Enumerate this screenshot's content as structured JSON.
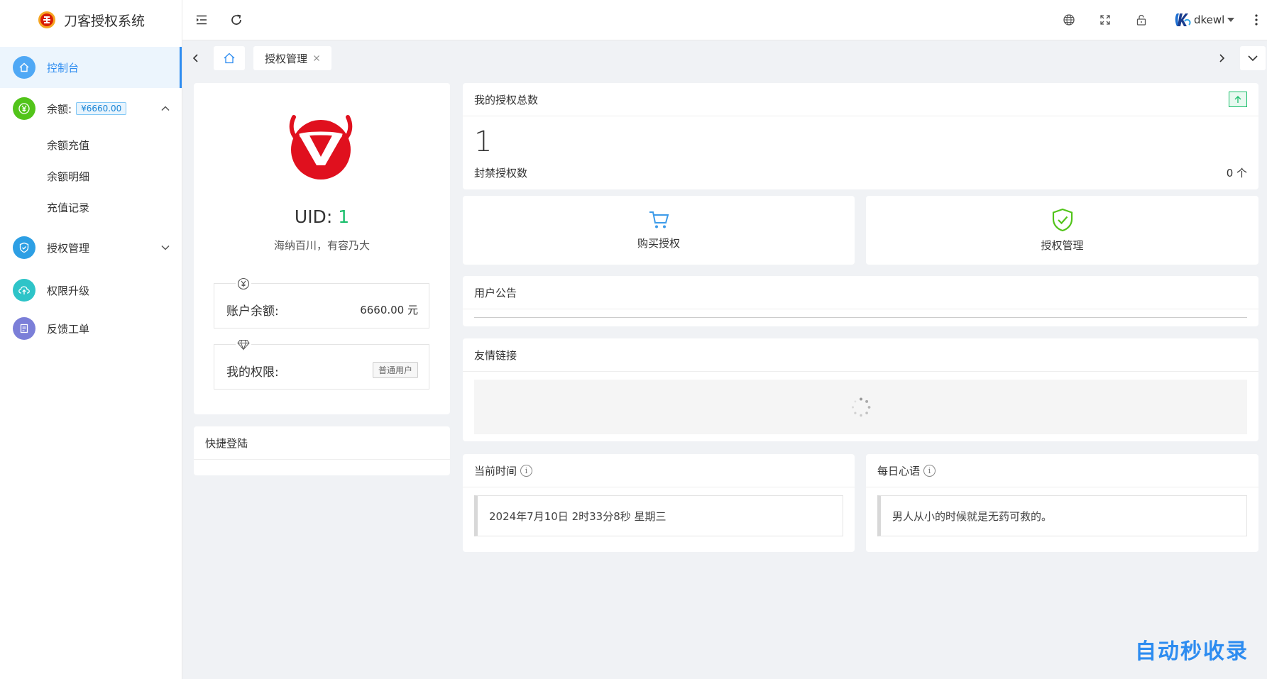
{
  "app": {
    "title": "刀客授权系统"
  },
  "sidebar": {
    "items": [
      {
        "label": "控制台",
        "icon": "home-icon",
        "color": "#4fa8f5",
        "active": true
      },
      {
        "label": "余额:",
        "badge": "¥6660.00",
        "icon": "yen-icon",
        "color": "#52c41a",
        "expanded": true,
        "children": [
          "余额充值",
          "余额明细",
          "充值记录"
        ]
      },
      {
        "label": "授权管理",
        "icon": "shield-icon",
        "color": "#2d9fe4",
        "expanded": false
      },
      {
        "label": "权限升级",
        "icon": "cloud-upload-icon",
        "color": "#2ec4c8"
      },
      {
        "label": "反馈工单",
        "icon": "document-icon",
        "color": "#7b7fd8"
      }
    ]
  },
  "header": {
    "icons": [
      "menu-fold-icon",
      "refresh-icon",
      "globe-icon",
      "fullscreen-icon",
      "lock-icon",
      "more-icon"
    ],
    "user": {
      "name": "dkewl"
    }
  },
  "tabs": [
    {
      "type": "home",
      "icon": "home-icon"
    },
    {
      "label": "授权管理",
      "closable": true
    }
  ],
  "profile": {
    "uid_label": "UID: ",
    "uid": "1",
    "motto": "海纳百川，有容乃大",
    "balance_label": "账户余额:",
    "balance_value": "6660.00 元",
    "role_label": "我的权限:",
    "role_value": "普通用户"
  },
  "quick_login": {
    "title": "快捷登陆"
  },
  "auth_stats": {
    "title": "我的授权总数",
    "total": "1",
    "banned_label": "封禁授权数",
    "banned_value": "0 个"
  },
  "quick_actions": [
    {
      "label": "购买授权",
      "icon": "cart-icon",
      "color": "#3d9be9"
    },
    {
      "label": "授权管理",
      "icon": "shield-check-icon",
      "color": "#52c41a"
    }
  ],
  "notice": {
    "title": "用户公告"
  },
  "links": {
    "title": "友情链接"
  },
  "current_time": {
    "title": "当前时间",
    "value": "2024年7月10日 2时33分8秒 星期三"
  },
  "daily_quote": {
    "title": "每日心语",
    "value": "男人从小的时候就是无药可救的。"
  },
  "watermark": "自动秒收录",
  "colors": {
    "accent": "#2d8cf0",
    "success": "#19be6b",
    "brand_red": "#e0101e"
  }
}
